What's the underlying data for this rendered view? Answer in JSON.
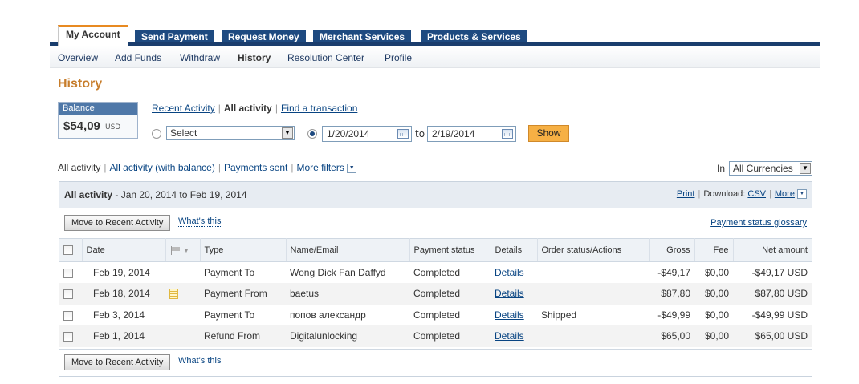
{
  "tabs": [
    {
      "label": "My Account",
      "active": true
    },
    {
      "label": "Send Payment",
      "active": false
    },
    {
      "label": "Request Money",
      "active": false
    },
    {
      "label": "Merchant Services",
      "active": false
    },
    {
      "label": "Products & Services",
      "active": false
    }
  ],
  "subnav": [
    {
      "label": "Overview"
    },
    {
      "label": "Add Funds"
    },
    {
      "label": "Withdraw"
    },
    {
      "label": "History",
      "active": true
    },
    {
      "label": "Resolution Center"
    },
    {
      "label": "Profile"
    }
  ],
  "page_title": "History",
  "balance": {
    "header": "Balance",
    "amount": "$54,09",
    "currency": "USD"
  },
  "views": {
    "recent": "Recent Activity",
    "all": "All activity",
    "find": "Find a transaction"
  },
  "period_select": {
    "value": "Select"
  },
  "date_range": {
    "from": "1/20/2014",
    "to_label": "to",
    "to": "2/19/2014",
    "show": "Show"
  },
  "filters": {
    "all": "All activity",
    "with_balance": "All activity (with balance)",
    "payments_sent": "Payments sent",
    "more": "More filters",
    "in_label": "In",
    "currency": "All Currencies"
  },
  "panel": {
    "title": "All activity",
    "range": "- Jan 20, 2014 to Feb 19, 2014",
    "print": "Print",
    "download_label": "Download:",
    "csv": "CSV",
    "more": "More",
    "move_button": "Move to Recent Activity",
    "whats_this": "What's this",
    "glossary": "Payment status glossary"
  },
  "columns": [
    "Date",
    "",
    "Type",
    "Name/Email",
    "Payment status",
    "Details",
    "Order status/Actions",
    "Gross",
    "Fee",
    "Net amount"
  ],
  "rows": [
    {
      "date": "Feb 19, 2014",
      "note": false,
      "type": "Payment To",
      "name": "Wong Dick Fan Daffyd",
      "status": "Completed",
      "details": "Details",
      "order": "",
      "gross": "-$49,17",
      "fee": "$0,00",
      "net": "-$49,17 USD"
    },
    {
      "date": "Feb 18, 2014",
      "note": true,
      "type": "Payment From",
      "name": "baetus",
      "status": "Completed",
      "details": "Details",
      "order": "",
      "gross": "$87,80",
      "fee": "$0,00",
      "net": "$87,80 USD"
    },
    {
      "date": "Feb 3, 2014",
      "note": false,
      "type": "Payment To",
      "name": "попов александр",
      "status": "Completed",
      "details": "Details",
      "order": "Shipped",
      "gross": "-$49,99",
      "fee": "$0,00",
      "net": "-$49,99 USD"
    },
    {
      "date": "Feb 1, 2014",
      "note": false,
      "type": "Refund From",
      "name": "Digitalunlocking",
      "status": "Completed",
      "details": "Details",
      "order": "",
      "gross": "$65,00",
      "fee": "$0,00",
      "net": "$65,00 USD"
    }
  ],
  "colors": {
    "accent": "#e88a21",
    "tab_blue": "#1e4a80",
    "title_orange": "#c77d2b",
    "link": "#084482"
  }
}
